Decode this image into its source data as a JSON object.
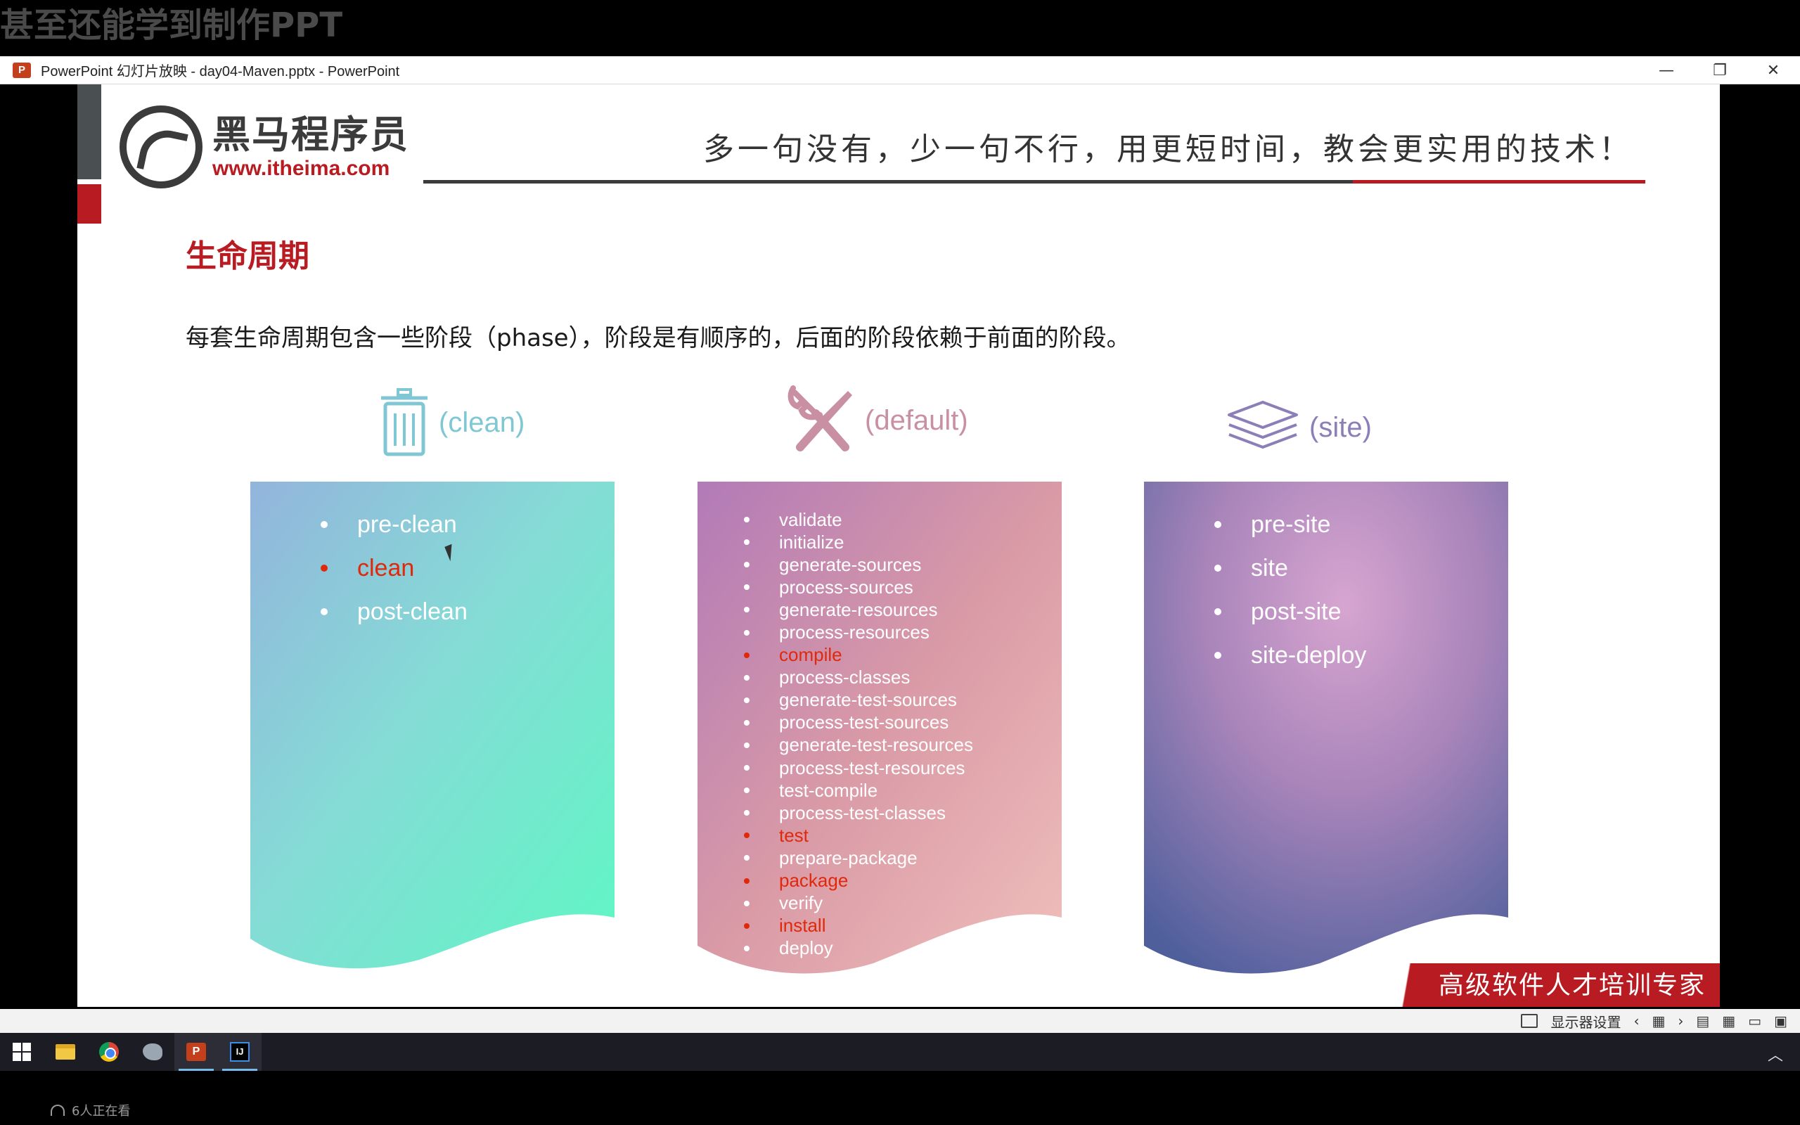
{
  "overlay": {
    "caption": "甚至还能学到制作PPT"
  },
  "window": {
    "app_icon": "P",
    "title": "PowerPoint 幻灯片放映  -  day04-Maven.pptx - PowerPoint",
    "controls": {
      "minimize": "—",
      "restore": "❐",
      "close": "✕"
    }
  },
  "slide": {
    "logo": {
      "name": "黑马程序员",
      "url": "www.itheima.com"
    },
    "slogan": "多一句没有，少一句不行，用更短时间，教会更实用的技术！",
    "title": "生命周期",
    "description": "每套生命周期包含一些阶段（phase），阶段是有顺序的，后面的阶段依赖于前面的阶段。",
    "columns": [
      {
        "label": "(clean)",
        "icon": "trash-icon",
        "color": "#7fc7d2",
        "items": [
          {
            "text": "pre-clean",
            "highlight": false
          },
          {
            "text": "clean",
            "highlight": true
          },
          {
            "text": "post-clean",
            "highlight": false
          }
        ]
      },
      {
        "label": "(default)",
        "icon": "wrench-screwdriver-icon",
        "color": "#c98fa2",
        "items": [
          {
            "text": "validate",
            "highlight": false
          },
          {
            "text": "initialize",
            "highlight": false
          },
          {
            "text": "generate-sources",
            "highlight": false
          },
          {
            "text": "process-sources",
            "highlight": false
          },
          {
            "text": "generate-resources",
            "highlight": false
          },
          {
            "text": "process-resources",
            "highlight": false
          },
          {
            "text": "compile",
            "highlight": true
          },
          {
            "text": "process-classes",
            "highlight": false
          },
          {
            "text": "generate-test-sources",
            "highlight": false
          },
          {
            "text": "process-test-sources",
            "highlight": false
          },
          {
            "text": "generate-test-resources",
            "highlight": false
          },
          {
            "text": "process-test-resources",
            "highlight": false
          },
          {
            "text": "test-compile",
            "highlight": false
          },
          {
            "text": "process-test-classes",
            "highlight": false
          },
          {
            "text": "test",
            "highlight": true
          },
          {
            "text": "prepare-package",
            "highlight": false
          },
          {
            "text": "package",
            "highlight": true
          },
          {
            "text": "verify",
            "highlight": false
          },
          {
            "text": "install",
            "highlight": true
          },
          {
            "text": "deploy",
            "highlight": false
          }
        ]
      },
      {
        "label": "(site)",
        "icon": "layers-icon",
        "color": "#8c7fb8",
        "items": [
          {
            "text": "pre-site",
            "highlight": false
          },
          {
            "text": "site",
            "highlight": false
          },
          {
            "text": "post-site",
            "highlight": false
          },
          {
            "text": "site-deploy",
            "highlight": false
          }
        ]
      }
    ],
    "corner_banner": "高级软件人才培训专家",
    "highlight_color": "#e0290a",
    "brand_red": "#b81c22"
  },
  "statusbar": {
    "display_settings": "显示器设置"
  },
  "taskbar": {
    "apps": [
      "windows-start-icon",
      "file-explorer-icon",
      "chrome-icon",
      "bird-app-icon",
      "powerpoint-icon",
      "intellij-icon"
    ],
    "ppt_label": "P",
    "ij_label": "IJ"
  },
  "stream": {
    "viewers": "6人正在看"
  }
}
